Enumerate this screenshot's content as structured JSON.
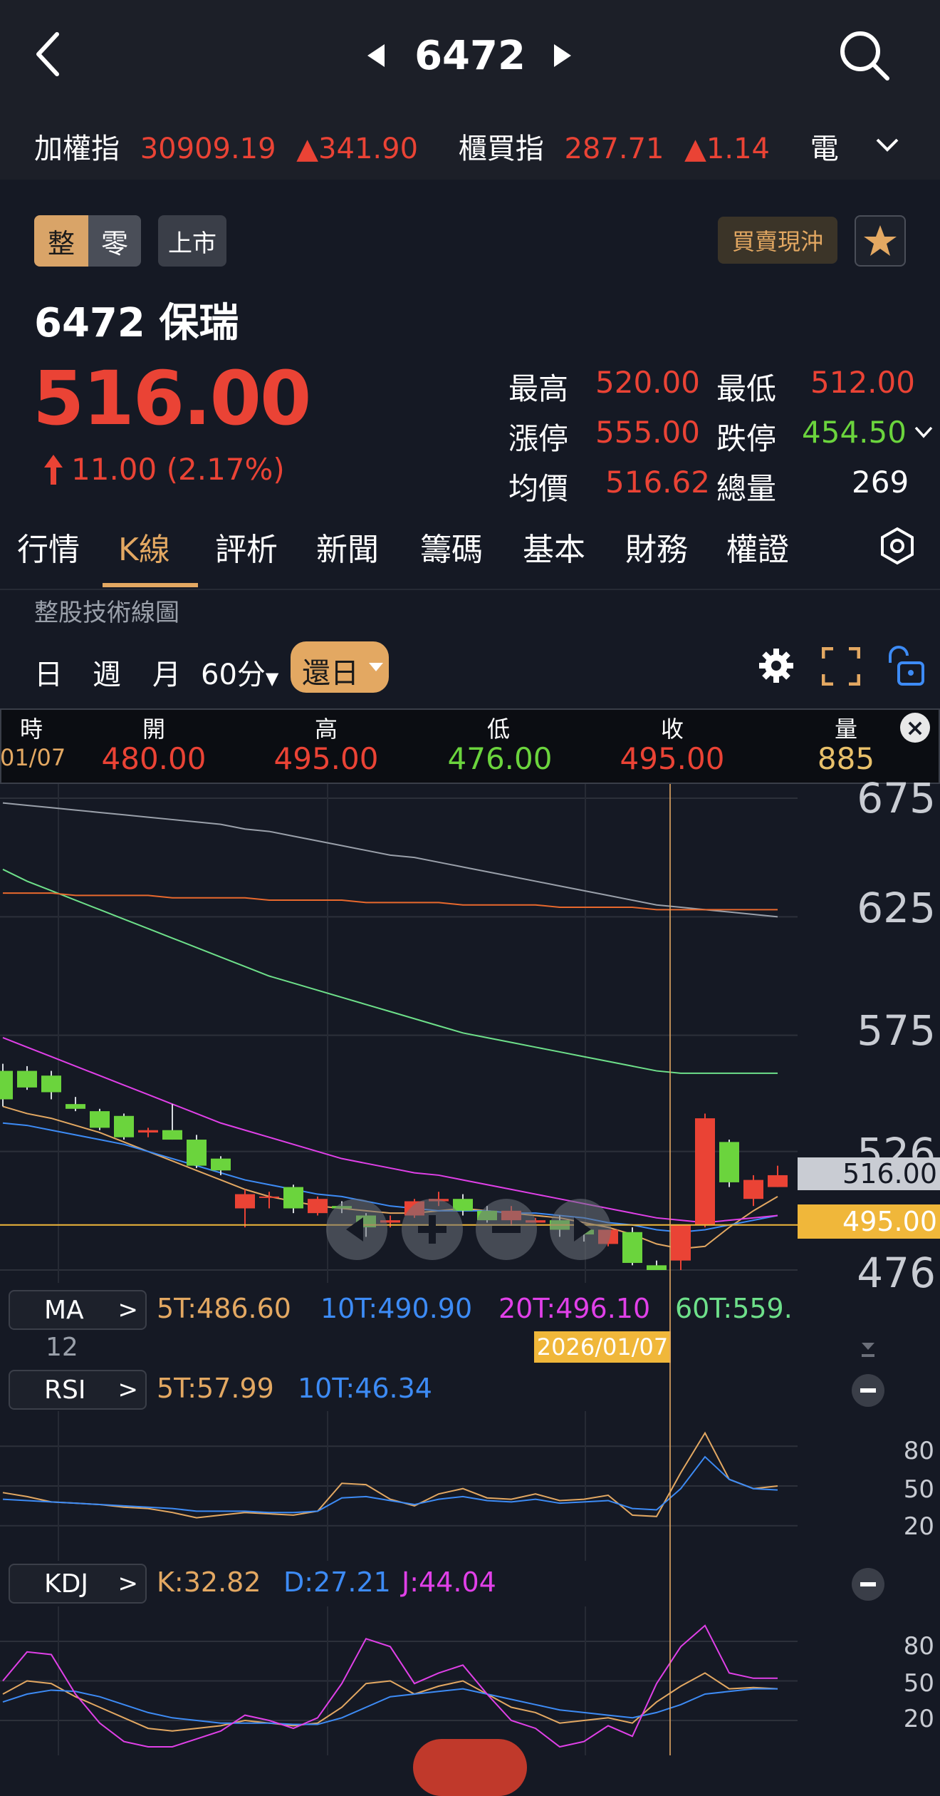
{
  "nav": {
    "title": "6472"
  },
  "indices": [
    {
      "name": "加權指",
      "value": "30909.19",
      "change": "▲341.90"
    },
    {
      "name": "櫃買指",
      "value": "287.71",
      "change": "▲1.14"
    },
    {
      "name": "電子扌",
      "value": "",
      "change": ""
    }
  ],
  "badges": {
    "whole": "整",
    "odd": "零",
    "market": "上市",
    "daytrade": "買賣現沖"
  },
  "stock": {
    "name": "6472 保瑞",
    "price": "516.00",
    "change": "11.00",
    "change_pct": "(2.17%)",
    "stats": [
      {
        "label": "最高",
        "value": "520.00",
        "color": "red"
      },
      {
        "label": "最低",
        "value": "512.00",
        "color": "red"
      },
      {
        "label": "漲停",
        "value": "555.00",
        "color": "red"
      },
      {
        "label": "跌停",
        "value": "454.50",
        "color": "green"
      },
      {
        "label": "均價",
        "value": "516.62",
        "color": "red"
      },
      {
        "label": "總量",
        "value": "269",
        "color": "white"
      }
    ]
  },
  "tabs": [
    "行情",
    "K線",
    "評析",
    "新聞",
    "籌碼",
    "基本",
    "財務",
    "權證"
  ],
  "active_tab": "K線",
  "section_title": "整股技術線圖",
  "periods": [
    "日",
    "週",
    "月",
    "60分",
    "還日"
  ],
  "active_period": "還日",
  "ohlc": {
    "headers": [
      "時",
      "開",
      "高",
      "低",
      "收",
      "量"
    ],
    "time": "01/07",
    "open": "480.00",
    "high": "495.00",
    "low": "476.00",
    "close": "495.00",
    "volume": "885"
  },
  "price_axis": {
    "labels": [
      "675",
      "625",
      "575",
      "526",
      "476"
    ],
    "current": "516.00",
    "cursor": "495.00"
  },
  "ma": {
    "label": "MA",
    "items": [
      {
        "text": "5T:486.60",
        "color": "#e3a862"
      },
      {
        "text": "10T:490.90",
        "color": "#3d8bf5"
      },
      {
        "text": "20T:496.10",
        "color": "#e040e8"
      },
      {
        "text": "60T:559.",
        "color": "#6ee08a"
      }
    ],
    "extra": "12"
  },
  "cursor_date": "2026/01/07",
  "rsi": {
    "label": "RSI",
    "items": [
      {
        "text": "5T:57.99",
        "color": "#e3a862"
      },
      {
        "text": "10T:46.34",
        "color": "#3d8bf5"
      }
    ],
    "axis": [
      "80",
      "50",
      "20"
    ]
  },
  "kdj": {
    "label": "KDJ",
    "items": [
      {
        "text": "K:32.82",
        "color": "#e3a862"
      },
      {
        "text": "D:27.21",
        "color": "#3d8bf5"
      },
      {
        "text": "J:44.04",
        "color": "#e040e8"
      }
    ],
    "axis": [
      "80",
      "50",
      "20"
    ]
  },
  "colors": {
    "up": "#ea4335",
    "down": "#6bd43d",
    "accent": "#e3a862",
    "bg": "#151924"
  },
  "chart_data": [
    {
      "type": "candlestick",
      "ylim": [
        476,
        675
      ],
      "yticks": [
        675,
        625,
        575,
        526,
        476
      ],
      "candles": [
        {
          "o": 560,
          "h": 563,
          "l": 545,
          "c": 548
        },
        {
          "o": 560,
          "h": 562,
          "l": 552,
          "c": 553
        },
        {
          "o": 558,
          "h": 560,
          "l": 548,
          "c": 551
        },
        {
          "o": 546,
          "h": 549,
          "l": 543,
          "c": 544
        },
        {
          "o": 543,
          "h": 544,
          "l": 535,
          "c": 536
        },
        {
          "o": 541,
          "h": 542,
          "l": 531,
          "c": 532
        },
        {
          "o": 534,
          "h": 536,
          "l": 532,
          "c": 535
        },
        {
          "o": 535,
          "h": 546,
          "l": 531,
          "c": 531
        },
        {
          "o": 531,
          "h": 533,
          "l": 519,
          "c": 520
        },
        {
          "o": 523,
          "h": 524,
          "l": 516,
          "c": 518
        },
        {
          "o": 502,
          "h": 510,
          "l": 494,
          "c": 508
        },
        {
          "o": 507,
          "h": 509,
          "l": 502,
          "c": 507
        },
        {
          "o": 511,
          "h": 512,
          "l": 500,
          "c": 502
        },
        {
          "o": 500,
          "h": 507,
          "l": 499,
          "c": 506
        },
        {
          "o": 503,
          "h": 505,
          "l": 500,
          "c": 502
        },
        {
          "o": 499,
          "h": 500,
          "l": 490,
          "c": 494
        },
        {
          "o": 496,
          "h": 499,
          "l": 494,
          "c": 497
        },
        {
          "o": 499,
          "h": 506,
          "l": 498,
          "c": 505
        },
        {
          "o": 505,
          "h": 509,
          "l": 503,
          "c": 506
        },
        {
          "o": 506,
          "h": 508,
          "l": 499,
          "c": 501
        },
        {
          "o": 501,
          "h": 503,
          "l": 496,
          "c": 497
        },
        {
          "o": 497,
          "h": 503,
          "l": 493,
          "c": 501
        },
        {
          "o": 496,
          "h": 498,
          "l": 496,
          "c": 497
        },
        {
          "o": 497,
          "h": 499,
          "l": 490,
          "c": 493
        },
        {
          "o": 493,
          "h": 495,
          "l": 488,
          "c": 491
        },
        {
          "o": 487,
          "h": 493,
          "l": 486,
          "c": 493
        },
        {
          "o": 492,
          "h": 494,
          "l": 478,
          "c": 479
        },
        {
          "o": 478,
          "h": 480,
          "l": 476,
          "c": 476
        },
        {
          "o": 480,
          "h": 495,
          "l": 476,
          "c": 495
        },
        {
          "o": 495,
          "h": 542,
          "l": 494,
          "c": 540
        },
        {
          "o": 530,
          "h": 531,
          "l": 511,
          "c": 513
        },
        {
          "o": 506,
          "h": 516,
          "l": 503,
          "c": 514
        },
        {
          "o": 511,
          "h": 520,
          "l": 511,
          "c": 516
        }
      ],
      "ma": {
        "5T": [
          545,
          542,
          540,
          537,
          534,
          530,
          526,
          522,
          518,
          514,
          510,
          507,
          505,
          503,
          502,
          501,
          500,
          500,
          501,
          502,
          501,
          500,
          499,
          498,
          496,
          494,
          491,
          487,
          485,
          486,
          494,
          501,
          507
        ],
        "10T": [
          538,
          537,
          535,
          533,
          531,
          529,
          526,
          523,
          520,
          517,
          514,
          512,
          510,
          508,
          507,
          505,
          503,
          502,
          501,
          501,
          501,
          500,
          500,
          499,
          498,
          496,
          495,
          493,
          492,
          493,
          495,
          497,
          499
        ],
        "20T": [
          574,
          570,
          566,
          562,
          558,
          554,
          550,
          546,
          542,
          538,
          535,
          532,
          529,
          526,
          523,
          521,
          519,
          517,
          516,
          514,
          512,
          510,
          508,
          506,
          504,
          502,
          500,
          498,
          497,
          496,
          497,
          498,
          499
        ],
        "60T": [
          645,
          640,
          636,
          632,
          628,
          624,
          620,
          616,
          612,
          608,
          604,
          600,
          597,
          594,
          591,
          588,
          585,
          582,
          579,
          576,
          574,
          572,
          570,
          568,
          566,
          564,
          562,
          560,
          559,
          559,
          559,
          559,
          559
        ],
        "gray": [
          673,
          672,
          671,
          670,
          669,
          668,
          667,
          666,
          665,
          664,
          662,
          661,
          659,
          657,
          655,
          653,
          651,
          650,
          648,
          646,
          644,
          642,
          640,
          638,
          636,
          634,
          632,
          630,
          629,
          628,
          627,
          626,
          625
        ],
        "orange": [
          635,
          635,
          635,
          634,
          634,
          634,
          634,
          633,
          633,
          633,
          633,
          632,
          632,
          632,
          632,
          631,
          631,
          631,
          631,
          630,
          630,
          630,
          630,
          629,
          629,
          629,
          629,
          628,
          628,
          628,
          628,
          628,
          628
        ]
      }
    },
    {
      "type": "line",
      "name": "RSI",
      "ylim": [
        0,
        100
      ],
      "series": [
        {
          "name": "5T",
          "values": [
            45,
            42,
            38,
            37,
            36,
            34,
            33,
            30,
            26,
            28,
            30,
            29,
            28,
            31,
            52,
            51,
            40,
            35,
            44,
            48,
            41,
            40,
            44,
            39,
            40,
            43,
            28,
            27,
            60,
            90,
            55,
            48,
            50
          ]
        },
        {
          "name": "10T",
          "values": [
            40,
            39,
            38,
            37,
            36,
            35,
            34,
            33,
            31,
            31,
            31,
            30,
            30,
            31,
            41,
            42,
            39,
            36,
            40,
            42,
            39,
            38,
            40,
            37,
            38,
            39,
            33,
            32,
            48,
            72,
            55,
            48,
            47
          ]
        }
      ]
    },
    {
      "type": "line",
      "name": "KDJ",
      "ylim": [
        0,
        100
      ],
      "series": [
        {
          "name": "K",
          "values": [
            40,
            50,
            48,
            38,
            30,
            22,
            14,
            12,
            14,
            16,
            20,
            18,
            16,
            18,
            30,
            48,
            50,
            40,
            46,
            50,
            40,
            30,
            26,
            18,
            20,
            22,
            18,
            34,
            46,
            56,
            44,
            45,
            44
          ]
        },
        {
          "name": "D",
          "values": [
            34,
            40,
            43,
            42,
            38,
            32,
            26,
            22,
            20,
            18,
            18,
            18,
            17,
            17,
            22,
            30,
            38,
            40,
            42,
            44,
            40,
            36,
            32,
            28,
            26,
            24,
            22,
            26,
            32,
            40,
            42,
            44,
            44
          ]
        },
        {
          "name": "J",
          "values": [
            50,
            72,
            70,
            40,
            18,
            4,
            0,
            0,
            6,
            12,
            24,
            20,
            14,
            22,
            48,
            82,
            76,
            48,
            56,
            62,
            40,
            20,
            14,
            0,
            4,
            16,
            8,
            48,
            76,
            92,
            56,
            52,
            52
          ]
        }
      ]
    }
  ]
}
